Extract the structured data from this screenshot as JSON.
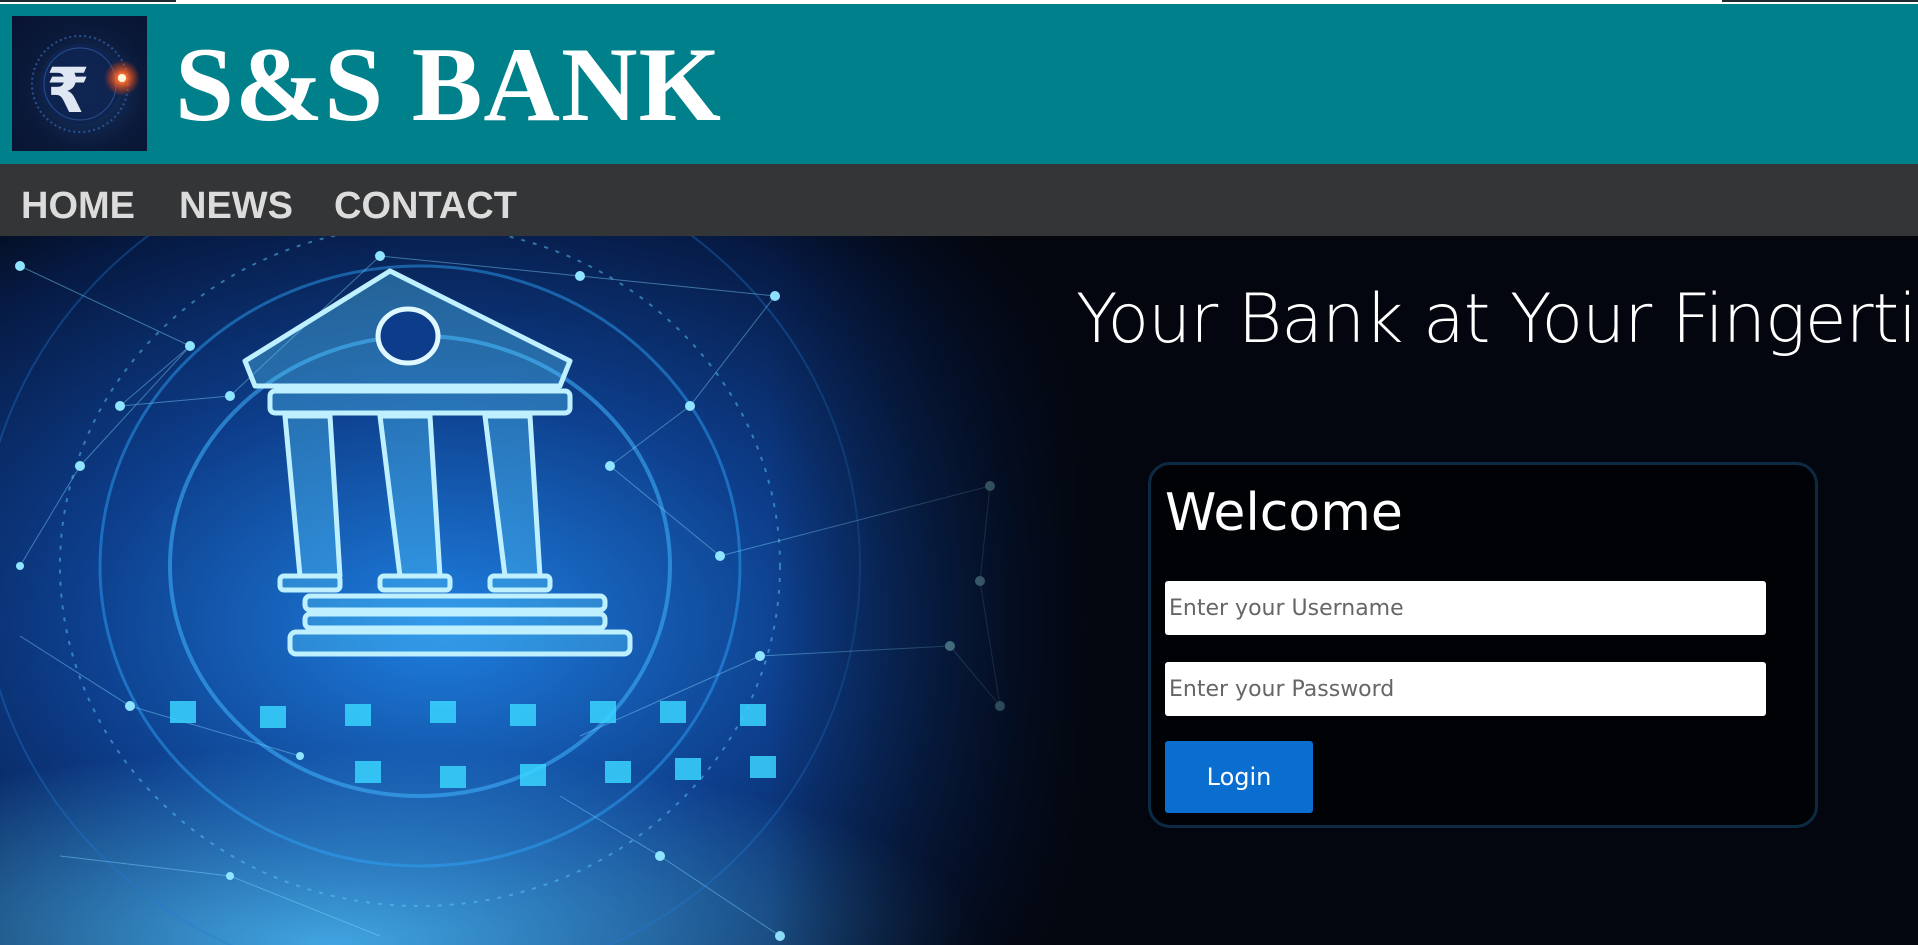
{
  "brand": {
    "name": "S&S BANK",
    "logo_icon": "rupee-coin-icon"
  },
  "nav": {
    "items": [
      {
        "label": "HOME"
      },
      {
        "label": "NEWS"
      },
      {
        "label": "CONTACT"
      }
    ]
  },
  "hero": {
    "tagline": "Your Bank at Your Fingertips.",
    "art_icon": "bank-building-icon"
  },
  "login": {
    "title": "Welcome",
    "username_placeholder": "Enter your Username",
    "username_value": "",
    "password_placeholder": "Enter your Password",
    "password_value": "",
    "button_label": "Login"
  },
  "colors": {
    "header_bg": "#00808a",
    "nav_bg": "#333536",
    "hero_bg": "#03060e",
    "button_bg": "#0a6ed1",
    "card_border": "#0c2a44"
  }
}
